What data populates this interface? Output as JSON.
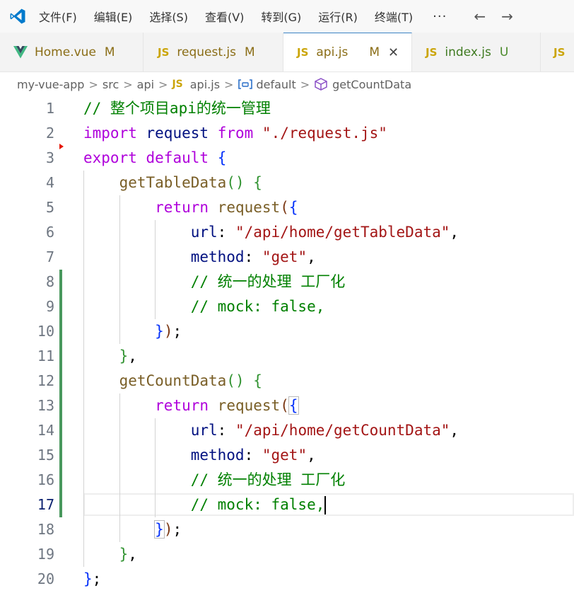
{
  "menu": [
    "文件(F)",
    "编辑(E)",
    "选择(S)",
    "查看(V)",
    "转到(G)",
    "运行(R)",
    "终端(T)"
  ],
  "menu_more": "···",
  "nav_back": "←",
  "nav_forward": "→",
  "tabs": [
    {
      "icon": "V",
      "name": "Home.vue",
      "status": "M"
    },
    {
      "icon": "JS",
      "name": "request.js",
      "status": "M"
    },
    {
      "icon": "JS",
      "name": "api.js",
      "status": "M",
      "close": "✕"
    },
    {
      "icon": "JS",
      "name": "index.js",
      "status": "U"
    },
    {
      "icon": "JS"
    }
  ],
  "breadcrumb": {
    "items": [
      "my-vue-app",
      "src",
      "api",
      "api.js",
      "default",
      "getCountData"
    ],
    "sep": ">",
    "js_badge": "JS"
  },
  "editor": {
    "current_line": 17,
    "line_numbers": [
      "1",
      "2",
      "3",
      "4",
      "5",
      "6",
      "7",
      "8",
      "9",
      "10",
      "11",
      "12",
      "13",
      "14",
      "15",
      "16",
      "17",
      "18",
      "19",
      "20"
    ],
    "lines": [
      [
        {
          "t": "// 整个项目api的统一管理",
          "c": "cm"
        }
      ],
      [
        {
          "t": "import",
          "c": "kw"
        },
        {
          "t": " "
        },
        {
          "t": "request",
          "c": "var"
        },
        {
          "t": " "
        },
        {
          "t": "from",
          "c": "kw"
        },
        {
          "t": " "
        },
        {
          "t": "\"./request.js\"",
          "c": "str"
        }
      ],
      [
        {
          "t": "export",
          "c": "kw"
        },
        {
          "t": " "
        },
        {
          "t": "default",
          "c": "kw"
        },
        {
          "t": " "
        },
        {
          "t": "{",
          "c": "b1"
        }
      ],
      [
        {
          "t": "    "
        },
        {
          "t": "getTableData",
          "c": "fn"
        },
        {
          "t": "()",
          "c": "b2"
        },
        {
          "t": " "
        },
        {
          "t": "{",
          "c": "b2"
        }
      ],
      [
        {
          "t": "        "
        },
        {
          "t": "return",
          "c": "kw"
        },
        {
          "t": " "
        },
        {
          "t": "request",
          "c": "fn"
        },
        {
          "t": "(",
          "c": "b3"
        },
        {
          "t": "{",
          "c": "b1"
        }
      ],
      [
        {
          "t": "            "
        },
        {
          "t": "url",
          "c": "prop"
        },
        {
          "t": ": "
        },
        {
          "t": "\"/api/home/getTableData\"",
          "c": "str"
        },
        {
          "t": ","
        }
      ],
      [
        {
          "t": "            "
        },
        {
          "t": "method",
          "c": "prop"
        },
        {
          "t": ": "
        },
        {
          "t": "\"get\"",
          "c": "str"
        },
        {
          "t": ","
        }
      ],
      [
        {
          "t": "            "
        },
        {
          "t": "// 统一的处理 工厂化",
          "c": "cm"
        }
      ],
      [
        {
          "t": "            "
        },
        {
          "t": "// mock: false,",
          "c": "cm"
        }
      ],
      [
        {
          "t": "        "
        },
        {
          "t": "}",
          "c": "b1"
        },
        {
          "t": ")",
          "c": "b3"
        },
        {
          "t": ";"
        }
      ],
      [
        {
          "t": "    "
        },
        {
          "t": "}",
          "c": "b2"
        },
        {
          "t": ","
        }
      ],
      [
        {
          "t": "    "
        },
        {
          "t": "getCountData",
          "c": "fn"
        },
        {
          "t": "()",
          "c": "b2"
        },
        {
          "t": " "
        },
        {
          "t": "{",
          "c": "b2"
        }
      ],
      [
        {
          "t": "        "
        },
        {
          "t": "return",
          "c": "kw"
        },
        {
          "t": " "
        },
        {
          "t": "request",
          "c": "fn"
        },
        {
          "t": "(",
          "c": "b3"
        },
        {
          "t": "{",
          "c": "b1",
          "m": true
        }
      ],
      [
        {
          "t": "            "
        },
        {
          "t": "url",
          "c": "prop"
        },
        {
          "t": ": "
        },
        {
          "t": "\"/api/home/getCountData\"",
          "c": "str"
        },
        {
          "t": ","
        }
      ],
      [
        {
          "t": "            "
        },
        {
          "t": "method",
          "c": "prop"
        },
        {
          "t": ": "
        },
        {
          "t": "\"get\"",
          "c": "str"
        },
        {
          "t": ","
        }
      ],
      [
        {
          "t": "            "
        },
        {
          "t": "// 统一的处理 工厂化",
          "c": "cm"
        }
      ],
      [
        {
          "t": "            "
        },
        {
          "t": "// mock: false,",
          "c": "cm"
        },
        {
          "caret": true
        }
      ],
      [
        {
          "t": "        "
        },
        {
          "t": "}",
          "c": "b1",
          "m": true
        },
        {
          "t": ")",
          "c": "b3"
        },
        {
          "t": ";"
        }
      ],
      [
        {
          "t": "    "
        },
        {
          "t": "}",
          "c": "b2"
        },
        {
          "t": ","
        }
      ],
      [
        {
          "t": "}",
          "c": "b1"
        },
        {
          "t": ";"
        }
      ]
    ]
  },
  "colors": {
    "keyword": "#af00db",
    "string": "#a31515",
    "function": "#795e26",
    "comment": "#008000",
    "modified_gutter": "#48985d",
    "active_tab_border": "#3b82c4"
  }
}
